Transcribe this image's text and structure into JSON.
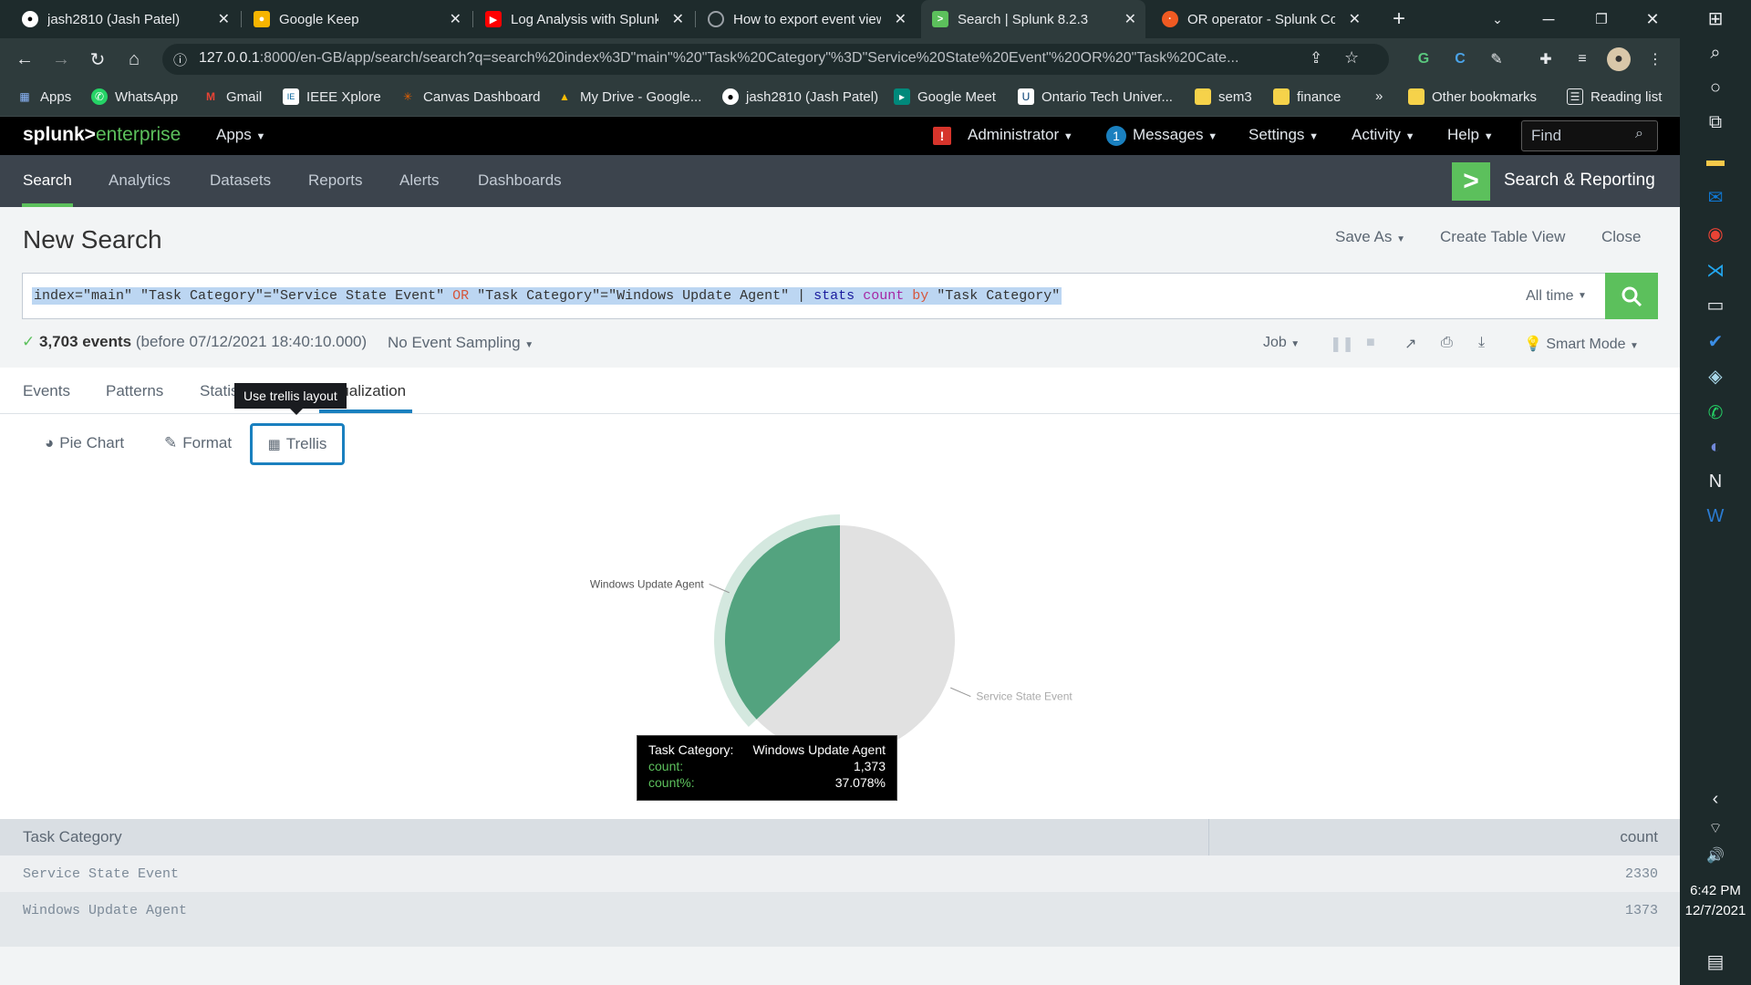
{
  "browser": {
    "tabs": [
      {
        "title": "jash2810 (Jash Patel)",
        "favicon": "github-icon",
        "color": "#ffffff"
      },
      {
        "title": "Google Keep",
        "favicon": "keep-icon",
        "color": "#f6b400"
      },
      {
        "title": "Log Analysis with Splunk",
        "favicon": "youtube-icon",
        "color": "#ff0000"
      },
      {
        "title": "How to export event view",
        "favicon": "loading-icon",
        "color": "#9aa0a6"
      },
      {
        "title": "Search | Splunk 8.2.3",
        "favicon": "splunk-icon",
        "color": "#5cc05c"
      },
      {
        "title": "OR operator - Splunk Cor",
        "favicon": "splunk-community-icon",
        "color": "#f05a22"
      }
    ],
    "url_host": "127.0.0.1",
    "url_rest": ":8000/en-GB/app/search/search?q=search%20index%3D\"main\"%20\"Task%20Category\"%3D\"Service%20State%20Event\"%20OR%20\"Task%20Cate...",
    "bookmarks": [
      "Apps",
      "WhatsApp",
      "Gmail",
      "IEEE Xplore",
      "Canvas Dashboard",
      "My Drive - Google...",
      "jash2810 (Jash Patel)",
      "Google Meet",
      "Ontario Tech Univer...",
      "sem3",
      "finance"
    ],
    "bookmarks_more": "»",
    "other_bookmarks": "Other bookmarks",
    "reading_list": "Reading list"
  },
  "splunk_bar": {
    "logo_left": "splunk>",
    "logo_right": "enterprise",
    "apps": "Apps",
    "administrator": "Administrator",
    "messages_count": "1",
    "messages": "Messages",
    "settings": "Settings",
    "activity": "Activity",
    "help": "Help",
    "find_placeholder": "Find"
  },
  "app_bar": {
    "nav": [
      "Search",
      "Analytics",
      "Datasets",
      "Reports",
      "Alerts",
      "Dashboards"
    ],
    "app_name": "Search & Reporting"
  },
  "page": {
    "title": "New Search",
    "save_as": "Save As",
    "create_table_view": "Create Table View",
    "close": "Close",
    "query": {
      "p1": "index=\"main\" \"Task Category\"=\"Service State Event\" ",
      "or": "OR",
      "p2": " \"Task Category\"=\"Windows Update Agent\" | ",
      "stats": "stats",
      "sp1": " ",
      "count": "count",
      "sp2": " ",
      "by": "by",
      "p3": " \"Task Category\""
    },
    "time_range": "All time",
    "events_count": "3,703 events",
    "events_before": "(before 07/12/2021 18:40:10.000)",
    "sampling": "No Event Sampling",
    "job": "Job",
    "smart_mode": "Smart Mode",
    "tabs": [
      "Events",
      "Patterns",
      "Statistics (2)",
      "Visualization"
    ],
    "viz_type": "Pie Chart",
    "format": "Format",
    "trellis": "Trellis",
    "tooltip": "Use trellis layout"
  },
  "chart_data": {
    "type": "pie",
    "categories": [
      "Service State Event",
      "Windows Update Agent"
    ],
    "values": [
      2330,
      1373
    ],
    "colors": [
      "#e1e1e1",
      "#53a37f"
    ],
    "hover": {
      "label_key": "Task Category:",
      "label_value": "Windows Update Agent",
      "count_key": "count:",
      "count_value": "1,373",
      "pct_key": "count%:",
      "pct_value": "37.078%"
    }
  },
  "table": {
    "headers": [
      "Task Category",
      "count"
    ],
    "rows": [
      [
        "Service State Event",
        "2330"
      ],
      [
        "Windows Update Agent",
        "1373"
      ]
    ]
  },
  "taskbar": {
    "time": "6:42 PM",
    "date": "12/7/2021"
  }
}
